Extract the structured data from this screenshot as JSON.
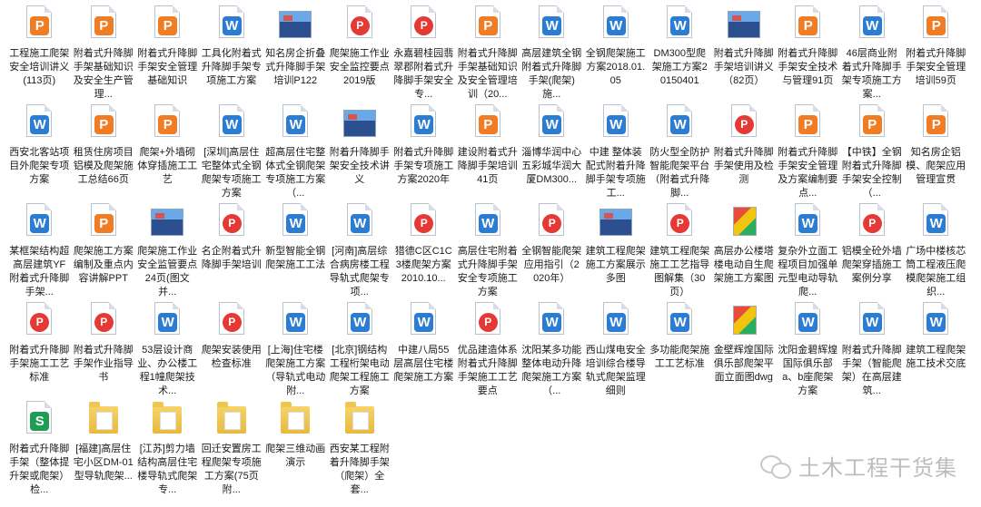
{
  "files": [
    {
      "icon": "pdf-p",
      "label": "工程施工爬架安全培训讲义(113页)"
    },
    {
      "icon": "pdf-p",
      "label": "附着式升降脚手架基础知识及安全生产管理..."
    },
    {
      "icon": "pdf-p",
      "label": "附着式升降脚手架安全管理基础知识"
    },
    {
      "icon": "word",
      "label": "工具化附着式升降脚手架专项施工方案"
    },
    {
      "icon": "image",
      "label": "知名房企折叠式升降脚手架培训P122"
    },
    {
      "icon": "pdf-red",
      "label": "爬架施工作业安全监控要点2019版"
    },
    {
      "icon": "pdf-red",
      "label": "永嘉碧桂园翡翠郡附着式升降脚手架安全专..."
    },
    {
      "icon": "pdf-p",
      "label": "附着式升降脚手架基础知识及安全管理培训（20..."
    },
    {
      "icon": "word",
      "label": "高层建筑全钢附着式升降脚手架(爬架)施..."
    },
    {
      "icon": "word",
      "label": "全钢爬架施工方案2018.01.05"
    },
    {
      "icon": "word",
      "label": "DM300型爬架施工方案20150401"
    },
    {
      "icon": "image",
      "label": "附着式升降脚手架培训讲义（82页）"
    },
    {
      "icon": "pdf-p",
      "label": "附着式升降脚手架安全技术与管理91页"
    },
    {
      "icon": "word",
      "label": "46层商业附着式升降脚手架专项施工方案..."
    },
    {
      "icon": "pdf-p",
      "label": "附着式升降脚手架安全管理培训59页"
    },
    {
      "icon": "word",
      "label": "西安北客站项目外爬架专项方案"
    },
    {
      "icon": "pdf-p",
      "label": "租赁住房项目铝模及爬架施工总结66页"
    },
    {
      "icon": "pdf-p",
      "label": "爬架+外墙砌体穿插施工工艺"
    },
    {
      "icon": "word",
      "label": "[深圳]高层住宅整体式全钢爬架专项施工方案"
    },
    {
      "icon": "word",
      "label": "超高层住宅整体式全钢爬架专项施工方案（..."
    },
    {
      "icon": "image",
      "label": "附着升降脚手架安全技术讲义"
    },
    {
      "icon": "word",
      "label": "附着式升降脚手架专项施工方案2020年"
    },
    {
      "icon": "pdf-p",
      "label": "建设附着式升降脚手架培训41页"
    },
    {
      "icon": "word",
      "label": "淄博华润中心五彩城华润大厦DM300..."
    },
    {
      "icon": "word",
      "label": "中建 整体装配式附着升降脚手架专项施工..."
    },
    {
      "icon": "word",
      "label": "防火型全防护智能爬架平台（附着式升降脚..."
    },
    {
      "icon": "pdf-red",
      "label": "附着式升降脚手架使用及检测"
    },
    {
      "icon": "pdf-p",
      "label": "附着式升降脚手架安全管理及方案编制要点..."
    },
    {
      "icon": "pdf-p",
      "label": "【中铁】全钢附着式升降脚手架安全控制（..."
    },
    {
      "icon": "pdf-p",
      "label": "知名房企铝模、爬架应用管理宣贯"
    },
    {
      "icon": "word",
      "label": "某框架结构超高层建筑YF附着式升降脚手架..."
    },
    {
      "icon": "pdf-p",
      "label": "爬架施工方案编制及重点内容讲解PPT"
    },
    {
      "icon": "image",
      "label": "爬架施工作业安全监管要点24页(图文并..."
    },
    {
      "icon": "pdf-red",
      "label": "名企附着式升降脚手架培训"
    },
    {
      "icon": "word",
      "label": "新型智能全钢爬架施工工法"
    },
    {
      "icon": "word",
      "label": "[河南]高层综合病房楼工程导轨式爬架专项..."
    },
    {
      "icon": "pdf-red",
      "label": "猎德C区C1C3楼爬架方案2010.10..."
    },
    {
      "icon": "word",
      "label": "高层住宅附着式升降脚手架安全专项施工方案"
    },
    {
      "icon": "pdf-red",
      "label": "全钢智能爬架应用指引（2020年）"
    },
    {
      "icon": "image",
      "label": "建筑工程爬架施工方案展示多图"
    },
    {
      "icon": "pdf-red",
      "label": "建筑工程爬架施工工艺指导图解集（30页）"
    },
    {
      "icon": "dwg",
      "label": "高层办公楼塔楼电动自生爬架施工方案图"
    },
    {
      "icon": "word",
      "label": "复杂外立面工程项目加强单元型电动导轨爬..."
    },
    {
      "icon": "pdf-red",
      "label": "铝模全砼外墙爬架穿插施工案例分享"
    },
    {
      "icon": "word",
      "label": "广场中楼核芯筒工程液压爬模爬架施工组织..."
    },
    {
      "icon": "pdf-red",
      "label": "附着式升降脚手架施工工艺标准"
    },
    {
      "icon": "pdf-red",
      "label": "附着式升降脚手架作业指导书"
    },
    {
      "icon": "word",
      "label": "53层设计商业、办公楼工程1幢爬架技术..."
    },
    {
      "icon": "pdf-red",
      "label": "爬架安装使用检查标准"
    },
    {
      "icon": "word",
      "label": "[上海]住宅楼爬架施工方案（导轨式电动附..."
    },
    {
      "icon": "word",
      "label": "[北京]钢结构工程桁架电动爬架工程施工方案"
    },
    {
      "icon": "word",
      "label": "中建八局55层高层住宅楼爬架施工方案"
    },
    {
      "icon": "pdf-red",
      "label": "优品建造体系附着式升降脚手架施工工艺要点"
    },
    {
      "icon": "word",
      "label": "沈阳某多功能整体电动升降爬架施工方案（..."
    },
    {
      "icon": "word",
      "label": "西山煤电安全培训综合楼导轨式爬架监理细则"
    },
    {
      "icon": "word",
      "label": "多功能爬架施工工艺标准"
    },
    {
      "icon": "dwg",
      "label": "金壁辉煌国际俱乐部爬架平面立面图dwg"
    },
    {
      "icon": "word",
      "label": "沈阳金碧辉煌国际俱乐部a、b座爬架方案"
    },
    {
      "icon": "word",
      "label": "附着式升降脚手架（智能爬架）在高层建筑..."
    },
    {
      "icon": "word",
      "label": "建筑工程爬架施工技术交底"
    },
    {
      "icon": "excel",
      "label": "附着式升降脚手架（整体提升架或爬架）检..."
    },
    {
      "icon": "folder",
      "label": "[福建]高层住宅小区DM-01型导轨爬架..."
    },
    {
      "icon": "folder",
      "label": "[江苏]剪力墙结构高层住宅楼导轨式爬架专..."
    },
    {
      "icon": "folder",
      "label": "回迁安置房工程爬架专项施工方案(75页 附..."
    },
    {
      "icon": "folder",
      "label": "爬架三维动画演示"
    },
    {
      "icon": "folder",
      "label": "西安某工程附着升降脚手架（爬架）全套..."
    }
  ],
  "watermark": {
    "text": "土木工程干货集",
    "icon": "wechat-icon"
  },
  "badge_letters": {
    "pdf-p": "P",
    "word": "W",
    "excel": "S",
    "pdf-red": "P"
  }
}
